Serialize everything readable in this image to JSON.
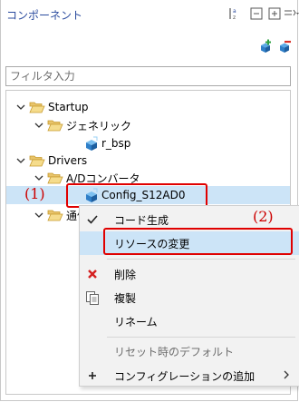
{
  "panel": {
    "title": "コンポーネント",
    "filter_placeholder": "フィルタ入力"
  },
  "tree": [
    {
      "label": "Startup",
      "kind": "folder",
      "expanded": true
    },
    {
      "label": "ジェネリック",
      "kind": "folder",
      "expanded": true
    },
    {
      "label": "r_bsp",
      "kind": "component"
    },
    {
      "label": "Drivers",
      "kind": "folder",
      "expanded": true
    },
    {
      "label": "A/Dコンバータ",
      "kind": "folder",
      "expanded": true
    },
    {
      "label": "Config_S12AD0",
      "kind": "component",
      "selected": true
    },
    {
      "label": "通信",
      "kind": "folder",
      "expanded": true
    }
  ],
  "context_menu": {
    "items": [
      {
        "label": "コード生成",
        "icon": "check-icon",
        "checked": true
      },
      {
        "label": "リソースの変更",
        "highlighted": true
      },
      {
        "label": "削除",
        "icon": "delete-icon"
      },
      {
        "label": "複製",
        "icon": "copy-icon"
      },
      {
        "label": "リネーム"
      },
      {
        "label": "リセット時のデフォルト",
        "disabled": true
      },
      {
        "label": "コンフィグレーションの追加",
        "icon": "plus-icon",
        "submenu": true
      }
    ]
  },
  "callouts": {
    "one": "(1)",
    "two": "(2)"
  },
  "colors": {
    "accent_red": "#e00000",
    "selection": "#cce4f7",
    "title_blue": "#2b4b9e"
  }
}
